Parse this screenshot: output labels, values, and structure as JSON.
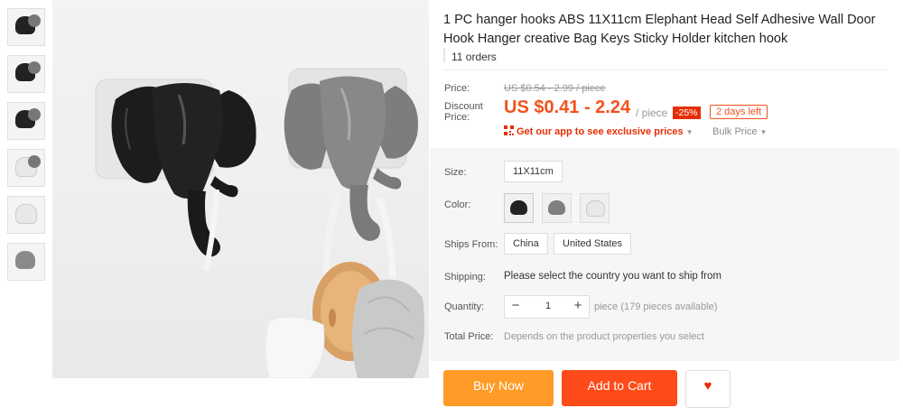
{
  "thumbnails": [
    {
      "label": "thumbnail 1",
      "style": "b"
    },
    {
      "label": "thumbnail 2",
      "style": "b"
    },
    {
      "label": "thumbnail 3",
      "style": "b"
    },
    {
      "label": "thumbnail 4",
      "style": "w"
    },
    {
      "label": "thumbnail 5",
      "style": "w"
    },
    {
      "label": "thumbnail 6",
      "style": "g"
    }
  ],
  "product": {
    "title": "1 PC hanger hooks ABS 11X11cm Elephant Head Self Adhesive Wall Door Hook Hanger creative Bag Keys Sticky Holder kitchen hook",
    "orders": "11 orders"
  },
  "price": {
    "price_label": "Price:",
    "old_price": "US $0.54 - 2.99 / piece",
    "discount_label": "Discount Price:",
    "new_price": "US $0.41 - 2.24",
    "unit": "/ piece",
    "discount_pct": "-25%",
    "days_left": "2 days left",
    "app_text": "Get our app to see exclusive prices",
    "bulk_price": "Bulk Price"
  },
  "options": {
    "size_label": "Size:",
    "size_value": "11X11cm",
    "color_label": "Color:",
    "ships_label": "Ships From:",
    "ships_options": [
      "China",
      "United States"
    ],
    "shipping_label": "Shipping:",
    "shipping_text": "Please select the country you want to ship from",
    "quantity_label": "Quantity:",
    "quantity_value": "1",
    "minus": "−",
    "plus": "+",
    "available": "piece (179 pieces available)",
    "total_label": "Total Price:",
    "total_text": "Depends on the product properties you select"
  },
  "buttons": {
    "buy_now": "Buy Now",
    "add_to_cart": "Add to Cart",
    "wishlist_icon": "heart-icon"
  },
  "colors": {
    "accent": "#f4511e",
    "discount_red": "#e62e04",
    "buy_orange": "#ff9b26",
    "cart_orange": "#ff4b1a"
  }
}
